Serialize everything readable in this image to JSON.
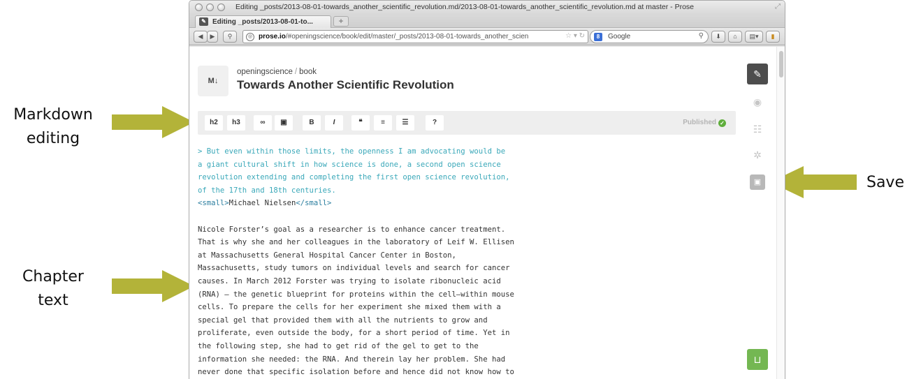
{
  "annotations": {
    "markdown_line1": "Markdown",
    "markdown_line2": "editing",
    "save": "Save",
    "chapter_line1": "Chapter",
    "chapter_line2": "text",
    "arrow_color": "#b3b339"
  },
  "window": {
    "title": "Editing _posts/2013-08-01-towards_another_scientific_revolution.md/2013-08-01-towards_another_scientific_revolution.md at master - Prose",
    "tab_label": "Editing _posts/2013-08-01-to...",
    "new_tab": "+"
  },
  "navbar": {
    "url_host": "prose.io",
    "url_path": "/#openingscience/book/edit/master/_posts/2013-08-01-towards_another_scien",
    "search_placeholder": "Google",
    "search_engine_letter": "8"
  },
  "header": {
    "format_badge": "M↓",
    "owner": "openingscience",
    "separator": "/",
    "repo": "book",
    "title": "Towards Another Scientific Revolution"
  },
  "toolbar": {
    "buttons": [
      "h2",
      "h3",
      "∞",
      "▣",
      "B",
      "I",
      "❝",
      "≡",
      "☰",
      "?"
    ],
    "status": "Published",
    "status_icon": "check-icon",
    "status_color": "#5fae3c"
  },
  "editor": {
    "quote_lines": [
      "> But even within those limits, the openness I am advocating would be",
      "a giant cultural shift in how science is done, a second open science",
      "revolution extending and completing the first open science revolution,",
      "of the 17th and 18th centuries."
    ],
    "small_open": "<small>",
    "small_text": "Michael Nielsen",
    "small_close": "</small>",
    "body_lines": [
      "Nicole Forster’s goal as a researcher is to enhance cancer treatment.",
      "That is why she and her colleagues in the laboratory of Leif W. Ellisen",
      "at Massachusetts General Hospital Cancer Center in Boston,",
      "Massachusetts, study tumors on individual levels and search for cancer",
      "causes. In March 2012 Forster was trying to isolate ribonucleic acid",
      "(RNA) – the genetic blueprint for proteins within the cell—within mouse",
      "cells. To prepare the cells for her experiment she mixed them with a",
      "special gel that provided them with all the nutrients to grow and",
      "proliferate, even outside the body, for a short period of time. Yet in",
      "the following step, she had to get rid of the gel to get to the",
      "information she needed: the RNA. And therein lay her problem. She had",
      "never done that specific isolation before and hence did not know how to"
    ]
  },
  "sidebar": {
    "edit_icon": "✎",
    "preview_icon": "◉",
    "meta_icon": "☷",
    "settings_icon": "✲",
    "save_icon": "▣",
    "commit_icon": "⊔",
    "active_color": "#4d4d4d",
    "commit_color": "#74b752"
  }
}
